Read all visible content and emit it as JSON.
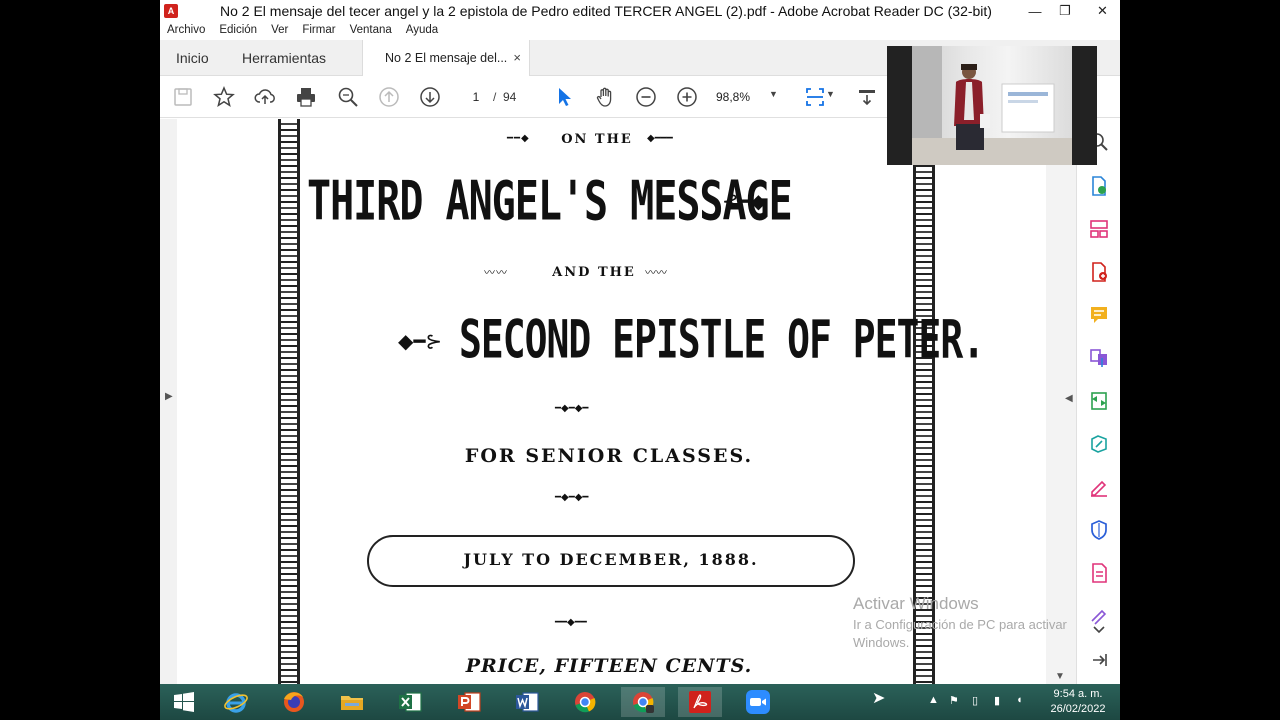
{
  "window": {
    "title": "No 2 El mensaje del tecer angel y la 2 epistola de Pedro edited TERCER ANGEL (2).pdf - Adobe Acrobat Reader DC (32-bit)",
    "app_icon_label": "A"
  },
  "menu": [
    "Archivo",
    "Edición",
    "Ver",
    "Firmar",
    "Ventana",
    "Ayuda"
  ],
  "tabs": {
    "home": "Inicio",
    "tools": "Herramientas",
    "document": "No 2 El mensaje del...",
    "close_glyph": "×"
  },
  "toolbar": {
    "current_page": "1",
    "page_separator": "/",
    "page_count": "94",
    "zoom": "98,8%"
  },
  "document": {
    "line1": "ON THE",
    "line2": "THIRD ANGEL'S MESSAGE",
    "line3": "AND THE",
    "line4": "SECOND EPISTLE OF PETER.",
    "line5": "FOR SENIOR CLASSES.",
    "line6": "JULY TO DECEMBER, 1888.",
    "line7": "PRICE, FIFTEEN CENTS."
  },
  "watermark": {
    "title": "Activar Windows",
    "subtitle": "Ir a Configuración de PC para activar Windows."
  },
  "clock": {
    "time": "9:54 a. m.",
    "date": "26/02/2022"
  },
  "colors": {
    "accent": "#1473e6",
    "acrobat_red": "#d0221c",
    "taskbar": "#1f4a45",
    "tool_green": "#2ca24f",
    "tool_purple": "#8a57d6",
    "tool_pink": "#e0347a",
    "tool_yellow": "#f2b01e"
  }
}
